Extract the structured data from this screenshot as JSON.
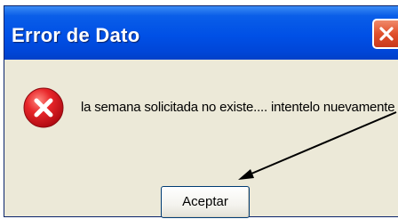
{
  "dialog": {
    "title": "Error de Dato",
    "message": "la semana solicitada no existe.... intentelo nuevamente",
    "ok_label": "Aceptar"
  },
  "icons": {
    "title_close": "close-icon",
    "message": "error-icon",
    "annotation": "arrow-icon"
  },
  "colors": {
    "title_bar": "#0050e6",
    "close_button": "#e0502c",
    "dialog_face": "#ece9d8",
    "error_icon": "#d4141e",
    "arrow": "#000000"
  }
}
